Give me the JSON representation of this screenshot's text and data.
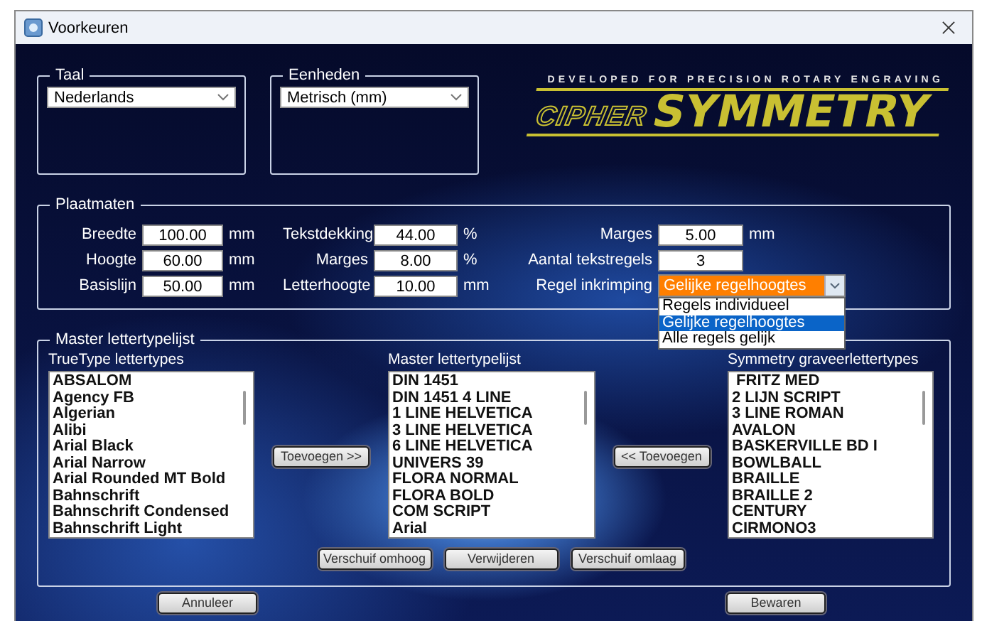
{
  "window": {
    "title": "Voorkeuren"
  },
  "logo": {
    "tagline": "DEVELOPED FOR PRECISION ROTARY ENGRAVING",
    "brand_left": "CIPHER",
    "brand_right": "SYMMETRY"
  },
  "language": {
    "label": "Taal",
    "value": "Nederlands"
  },
  "units": {
    "label": "Eenheden",
    "value": "Metrisch (mm)"
  },
  "plate": {
    "title": "Plaatmaten",
    "rows": [
      [
        {
          "kind": "number",
          "label": "Breedte",
          "value": "100.00",
          "unit": "mm"
        },
        {
          "kind": "number",
          "label": "Tekstdekking",
          "value": "44.00",
          "unit": "%"
        },
        {
          "kind": "number",
          "label": "Marges",
          "value": "5.00",
          "unit": "mm"
        }
      ],
      [
        {
          "kind": "number",
          "label": "Hoogte",
          "value": "60.00",
          "unit": "mm"
        },
        {
          "kind": "number",
          "label": "Marges",
          "value": "8.00",
          "unit": "%"
        },
        {
          "kind": "number",
          "label": "Aantal tekstregels",
          "value": "3"
        }
      ],
      [
        {
          "kind": "number",
          "label": "Basislijn",
          "value": "50.00",
          "unit": "mm"
        },
        {
          "kind": "number",
          "label": "Letterhoogte",
          "value": "10.00",
          "unit": "mm"
        },
        {
          "kind": "dropdown",
          "label": "Regel inkrimping",
          "value": "Gelijke regelhoogtes",
          "focused": true,
          "expanded": true,
          "options": [
            {
              "label": "Regels individueel",
              "selected": false
            },
            {
              "label": "Gelijke regelhoogtes",
              "selected": true
            },
            {
              "label": "Alle regels gelijk",
              "selected": false
            }
          ]
        }
      ]
    ]
  },
  "font_list": {
    "title": "Master lettertypelijst",
    "lists": [
      {
        "heading": "TrueType lettertypes",
        "items": [
          "ABSALOM",
          "Agency FB",
          "Algerian",
          "Alibi",
          "Arial Black",
          "Arial Narrow",
          "Arial Rounded MT Bold",
          "Bahnschrift",
          "Bahnschrift Condensed",
          "Bahnschrift Light"
        ]
      },
      {
        "heading": "Master lettertypelijst",
        "items": [
          "DIN 1451",
          "DIN 1451 4 LINE",
          "1 LINE HELVETICA",
          "3 LINE HELVETICA",
          "6 LINE HELVETICA",
          "UNIVERS 39",
          "FLORA NORMAL",
          "FLORA BOLD",
          "COM SCRIPT",
          "Arial"
        ]
      },
      {
        "heading": "Symmetry graveerlettertypes",
        "items": [
          " FRITZ MED",
          "2 LIJN SCRIPT",
          "3 LINE ROMAN",
          "AVALON",
          "BASKERVILLE BD I",
          "BOWLBALL",
          "BRAILLE",
          "BRAILLE 2",
          "CENTURY",
          "CIRMONO3"
        ]
      }
    ],
    "add_right": "Toevoegen >>",
    "add_left": "<< Toevoegen",
    "order_buttons": [
      "Verschuif omhoog",
      "Verwijderen",
      "Verschuif omlaag"
    ]
  },
  "footer_buttons": [
    "Annuleer",
    "Bewaren"
  ]
}
